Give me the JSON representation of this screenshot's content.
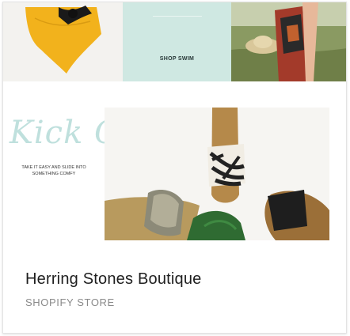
{
  "banner": {
    "shop_swim_label": "SHOP SWIM"
  },
  "hero": {
    "headline": "Kick Off",
    "tagline_line1": "TAKE IT EASY AND SLIDE INTO",
    "tagline_line2": "SOMETHING COMFY"
  },
  "store": {
    "name": "Herring Stones Boutique",
    "type": "SHOPIFY STORE"
  },
  "colors": {
    "teal_tile": "#cfe8e2",
    "swim_yellow": "#f2b21c",
    "title_text": "#1f1f1f",
    "subtitle_text": "#8a8a8a"
  }
}
